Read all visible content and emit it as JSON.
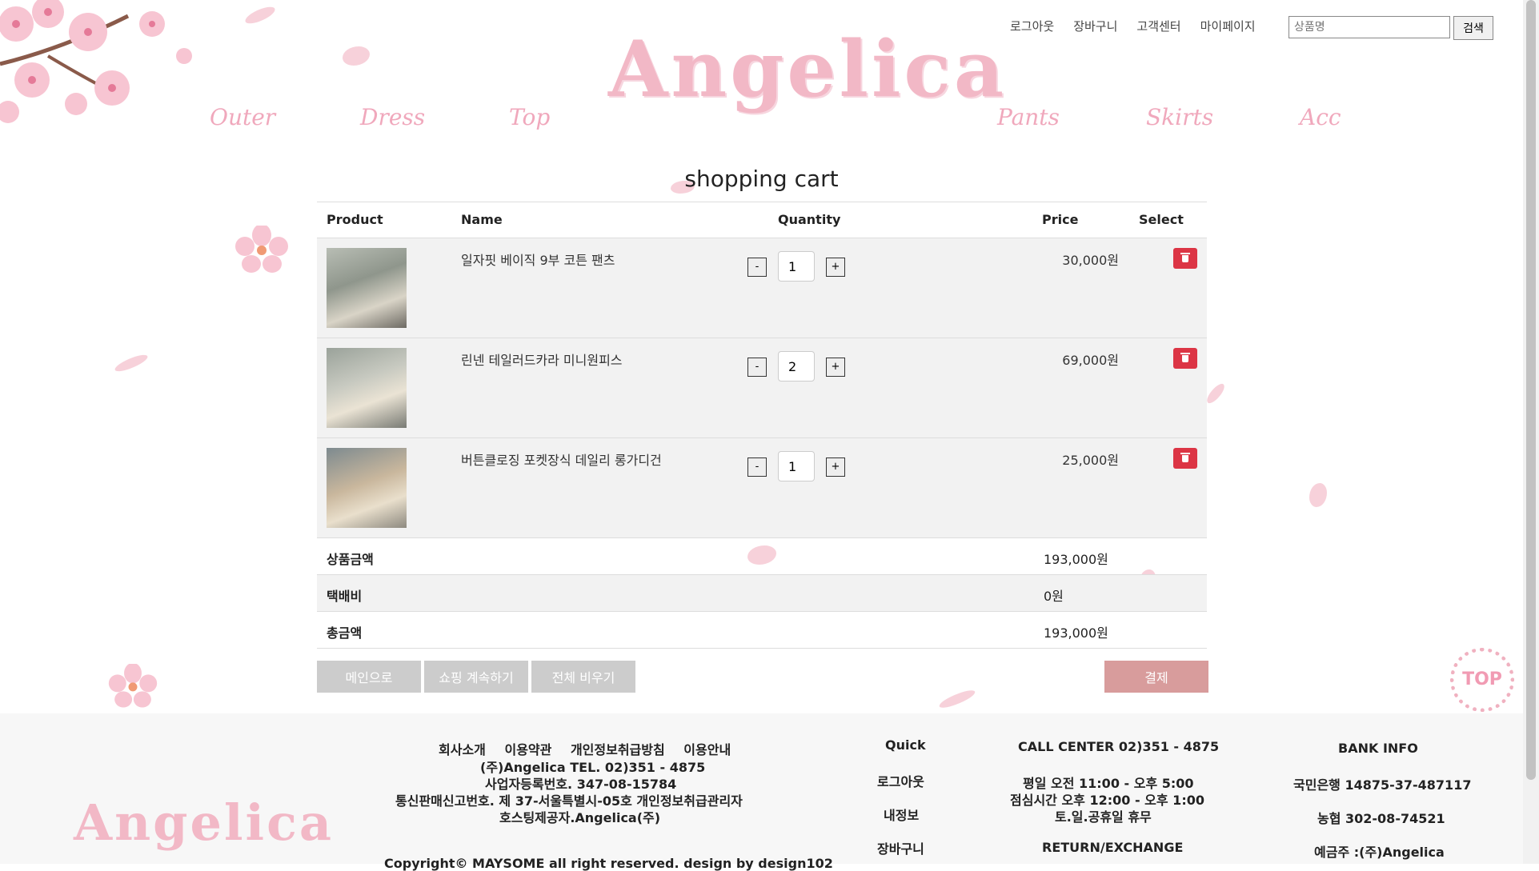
{
  "header": {
    "top_links": [
      "로그아웃",
      "장바구니",
      "고객센터",
      "마이페이지"
    ],
    "search_placeholder": "상품명",
    "search_button": "검색",
    "logo": "Angelica",
    "nav": [
      "Outer",
      "Dress",
      "Top",
      "Pants",
      "Skirts",
      "Acc"
    ]
  },
  "cart": {
    "title": "shopping cart",
    "columns": {
      "product": "Product",
      "name": "Name",
      "quantity": "Quantity",
      "price": "Price",
      "select": "Select"
    },
    "items": [
      {
        "name": "일자핏 베이직 9부 코튼 팬츠",
        "qty": "1",
        "price": "30,000원",
        "minus": "-",
        "plus": "+"
      },
      {
        "name": "린넨 테일러드카라 미니원피스",
        "qty": "2",
        "price": "69,000원",
        "minus": "-",
        "plus": "+"
      },
      {
        "name": "버튼클로징 포켓장식 데일리 롱가디건",
        "qty": "1",
        "price": "25,000원",
        "minus": "-",
        "plus": "+"
      }
    ],
    "summary": [
      {
        "label": "상품금액",
        "value": "193,000원"
      },
      {
        "label": "택배비",
        "value": "0원"
      },
      {
        "label": "총금액",
        "value": "193,000원"
      }
    ],
    "buttons": {
      "main": "메인으로",
      "continue": "쇼핑 계속하기",
      "clear": "전체 비우기",
      "pay": "결제"
    },
    "top_button": "TOP"
  },
  "footer": {
    "logo": "Angelica",
    "links": [
      "회사소개",
      "이용약관",
      "개인정보취급방침",
      "이용안내"
    ],
    "company_lines": [
      "(주)Angelica TEL. 02)351 - 4875",
      "사업자등록번호. 347-08-15784",
      "통신판매신고번호. 제 37-서울특별시-05호 개인정보취급관리자",
      "호스팅제공자.Angelica(주)",
      "Copyright© MAYSOME all right reserved. design by design102"
    ],
    "quick_title": "Quick",
    "quick_links": [
      "로그아웃",
      "내정보",
      "장바구니"
    ],
    "call_center": "CALL CENTER 02)351 - 4875",
    "hours": [
      "평일 오전 11:00 - 오후 5:00",
      "점심시간 오후 12:00 - 오후 1:00",
      "토.일.공휴일 휴무"
    ],
    "return_title": "RETURN/EXCHANGE",
    "bank_title": "BANK INFO",
    "banks": [
      "국민은행 14875-37-487117",
      "농협 302-08-74521",
      "예금주 :(주)Angelica"
    ]
  },
  "colors": {
    "accent_pink": "#f0a8bc",
    "pay_button": "#d89c9c",
    "delete_red": "#dc3545",
    "gray_button": "#cccccc"
  }
}
